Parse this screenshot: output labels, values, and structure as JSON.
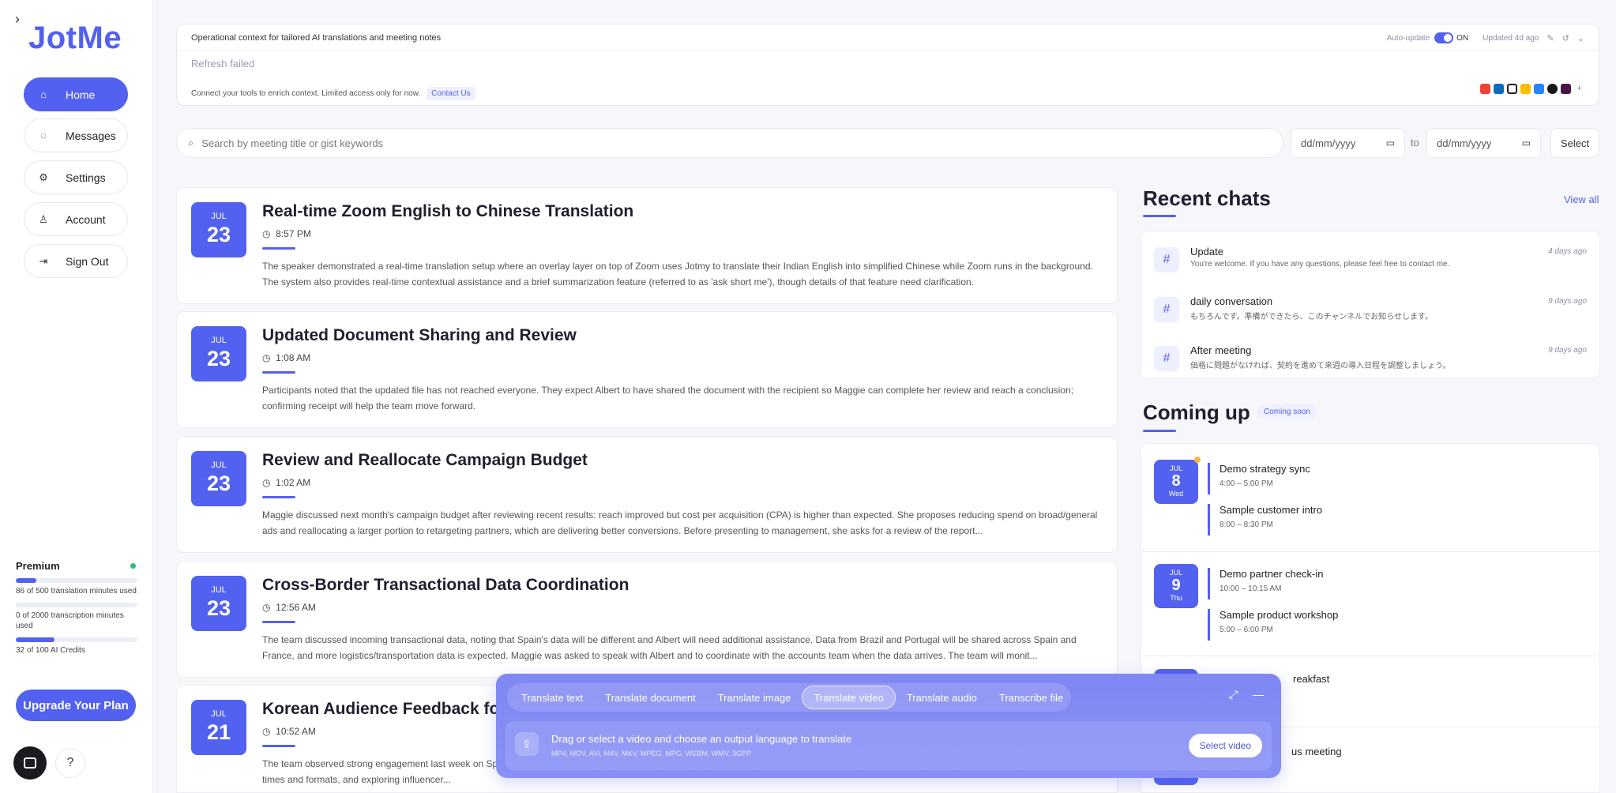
{
  "app": {
    "logo": "JotMe"
  },
  "sidebar": {
    "items": [
      {
        "label": "Home",
        "icon": "home-icon"
      },
      {
        "label": "Messages",
        "icon": "message-icon"
      },
      {
        "label": "Settings",
        "icon": "gear-icon"
      },
      {
        "label": "Account",
        "icon": "user-icon"
      },
      {
        "label": "Sign Out",
        "icon": "sign-out-icon"
      }
    ],
    "plan": {
      "name": "Premium",
      "usage": [
        {
          "label": "86 of 500 translation minutes used",
          "fraction": 0.172
        },
        {
          "label": "0 of 2000 transcription minutes used",
          "fraction": 0.0
        },
        {
          "label": "32 of 100 AI Credits",
          "fraction": 0.32
        }
      ]
    },
    "upgrade_label": "Upgrade Your Plan",
    "help_label": "?"
  },
  "context": {
    "title": "Operational context for tailored AI translations and meeting notes",
    "auto_update_label": "Auto-update",
    "auto_update_state": "ON",
    "updated": "Updated 4d ago",
    "refresh_status": "Refresh failed",
    "connect_text": "Connect your tools to enrich context. Limited access only for now.",
    "contact_label": "Contact Us",
    "integrations": [
      {
        "icon": "gmail-icon",
        "color": "#ea4335"
      },
      {
        "icon": "outlook-icon",
        "color": "#0f6cbd"
      },
      {
        "icon": "notion-icon",
        "color": "#222222"
      },
      {
        "icon": "google-drive-icon",
        "color": "#fbbc04"
      },
      {
        "icon": "jira-icon",
        "color": "#2684ff"
      },
      {
        "icon": "github-icon",
        "color": "#181717"
      },
      {
        "icon": "slack-icon",
        "color": "#4a154b"
      }
    ],
    "more_label": "+"
  },
  "search": {
    "placeholder": "Search by meeting title or gist keywords"
  },
  "date_filter": {
    "from_placeholder": "dd/mm/yyyy",
    "to_label": "to",
    "to_placeholder": "dd/mm/yyyy",
    "select_label": "Select"
  },
  "meetings": [
    {
      "month": "JUL",
      "day": "23",
      "title": "Real-time Zoom English to Chinese Translation",
      "time": "8:57 PM",
      "summary": "The speaker demonstrated a real-time translation setup where an overlay layer on top of Zoom uses Jotmy to translate their Indian English into simplified Chinese while Zoom runs in the background. The system also provides real-time contextual assistance and a brief summarization feature (referred to as 'ask short me'), though details of that feature need clarification."
    },
    {
      "month": "JUL",
      "day": "23",
      "title": "Updated Document Sharing and Review",
      "time": "1:08 AM",
      "summary": "Participants noted that the updated file has not reached everyone. They expect Albert to have shared the document with the recipient so Maggie can complete her review and reach a conclusion; confirming receipt will help the team move forward."
    },
    {
      "month": "JUL",
      "day": "23",
      "title": "Review and Reallocate Campaign Budget",
      "time": "1:02 AM",
      "summary": "Maggie discussed next month's campaign budget after reviewing recent results: reach improved but cost per acquisition (CPA) is higher than expected. She proposes reducing spend on broad/general ads and reallocating a larger portion to retargeting partners, which are delivering better conversions. Before presenting to management, she asks for a review of the report..."
    },
    {
      "month": "JUL",
      "day": "23",
      "title": "Cross-Border Transactional Data Coordination",
      "time": "12:56 AM",
      "summary": "The team discussed incoming transactional data, noting that Spain's data will be different and Albert will need additional assistance. Data from Brazil and Portugal will be shared across Spain and France, and more logistics/transportation data is expected. Maggie was asked to speak with Albert and to coordinate with the accounts team when the data arrives. The team will monit..."
    },
    {
      "month": "JUL",
      "day": "21",
      "title": "Korean Audience Feedback fo",
      "time": "10:52 AM",
      "summary": "The team observed strong engagement last week on Speaker 1 responded in Korean, analyzing Korea-specific engagement metrics, localizing content (subtitles, music, format), A/B testing posting times and formats, and exploring influencer..."
    }
  ],
  "recent_chats": {
    "title": "Recent chats",
    "view_all": "View all",
    "items": [
      {
        "name": "Update",
        "preview": "You're welcome. If you have any questions, please feel free to contact me.",
        "when": "4 days ago"
      },
      {
        "name": "daily conversation",
        "preview": "もちろんです。準備ができたら、このチャンネルでお知らせします。",
        "when": "9 days ago"
      },
      {
        "name": "After meeting",
        "preview": "価格に問題がなければ、契約を進めて来週の導入日程を調整しましょう。",
        "when": "9 days ago"
      }
    ]
  },
  "coming_up": {
    "title": "Coming up",
    "badge": "Coming soon",
    "days": [
      {
        "month": "JUL",
        "day": "8",
        "weekday": "Wed",
        "events": [
          {
            "title": "Demo strategy sync",
            "range": "4:00 – 5:00 PM"
          },
          {
            "title": "Sample customer intro",
            "range": "8:00 – 8:30 PM"
          }
        ]
      },
      {
        "month": "JUL",
        "day": "9",
        "weekday": "Thu",
        "events": [
          {
            "title": "Demo partner check-in",
            "range": "10:00 – 10:15 AM"
          },
          {
            "title": "Sample product workshop",
            "range": "5:00 – 6:00 PM"
          }
        ]
      }
    ],
    "partial_events": [
      "reakfast",
      "us meeting"
    ]
  },
  "translate_panel": {
    "tabs": [
      "Translate text",
      "Translate document",
      "Translate image",
      "Translate video",
      "Translate audio",
      "Transcribe file"
    ],
    "active_tab": "Translate video",
    "drop_hint": "Drag or select a video and choose an output language to translate",
    "formats": "MP4, MOV, AVI, M4V, MKV, MPEG, MPG, WEBM, WMV, 3GPP",
    "select_label": "Select video"
  },
  "colors": {
    "accent": "#5361f0",
    "panel": "#8089f4",
    "status_dot": "#2bbf7a"
  }
}
